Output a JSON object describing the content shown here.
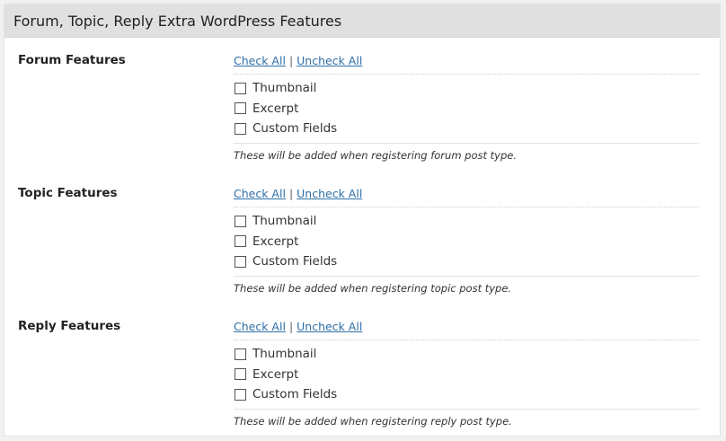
{
  "panel": {
    "title": "Forum, Topic, Reply Extra WordPress Features"
  },
  "sections": [
    {
      "label": "Forum Features",
      "check_all": "Check All",
      "separator": "|",
      "uncheck_all": "Uncheck All",
      "options": [
        {
          "label": "Thumbnail",
          "checked": false
        },
        {
          "label": "Excerpt",
          "checked": false
        },
        {
          "label": "Custom Fields",
          "checked": false
        }
      ],
      "note": "These will be added when registering forum post type."
    },
    {
      "label": "Topic Features",
      "check_all": "Check All",
      "separator": "|",
      "uncheck_all": "Uncheck All",
      "options": [
        {
          "label": "Thumbnail",
          "checked": false
        },
        {
          "label": "Excerpt",
          "checked": false
        },
        {
          "label": "Custom Fields",
          "checked": false
        }
      ],
      "note": "These will be added when registering topic post type."
    },
    {
      "label": "Reply Features",
      "check_all": "Check All",
      "separator": "|",
      "uncheck_all": "Uncheck All",
      "options": [
        {
          "label": "Thumbnail",
          "checked": false
        },
        {
          "label": "Excerpt",
          "checked": false
        },
        {
          "label": "Custom Fields",
          "checked": false
        }
      ],
      "note": "These will be added when registering reply post type."
    }
  ]
}
